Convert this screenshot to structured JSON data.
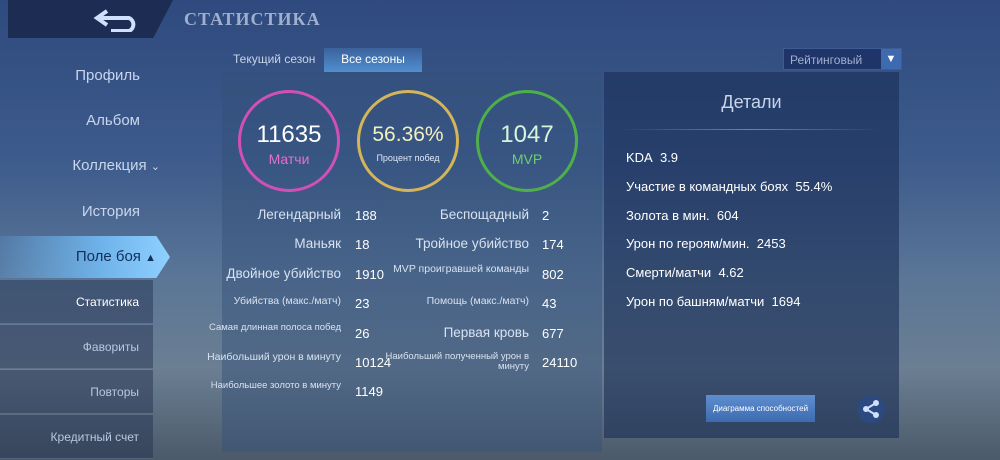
{
  "header": {
    "title": "СТАТИСТИКА"
  },
  "sidebar": {
    "items": [
      {
        "label": "Профиль"
      },
      {
        "label": "Альбом"
      },
      {
        "label": "Коллекция"
      },
      {
        "label": "История"
      },
      {
        "label": "Поле боя"
      }
    ],
    "sub_items": [
      {
        "label": "Статистика"
      },
      {
        "label": "Фавориты"
      },
      {
        "label": "Повторы"
      },
      {
        "label": "Кредитный счет"
      }
    ]
  },
  "tabs": [
    {
      "label": "Текущий сезон"
    },
    {
      "label": "Все сезоны"
    }
  ],
  "mode_select": {
    "value": "Рейтинговый"
  },
  "summary": [
    {
      "value": "11635",
      "label": "Матчи",
      "color": "#d24fb8"
    },
    {
      "value": "56.36%",
      "label": "Процент побед",
      "color": "#d4b55a"
    },
    {
      "value": "1047",
      "label": "MVP",
      "color": "#4fb04a"
    }
  ],
  "stats_left": [
    {
      "label": "Легендарный",
      "value": "188"
    },
    {
      "label": "Маньяк",
      "value": "18"
    },
    {
      "label": "Двойное убийство",
      "value": "1910"
    },
    {
      "label": "Убийства (макс./матч)",
      "value": "23"
    },
    {
      "label": "Самая длинная полоса побед",
      "value": "26"
    },
    {
      "label": "Наибольший урон в минуту",
      "value": "10124"
    },
    {
      "label": "Наибольшее золото в минуту",
      "value": "1149"
    }
  ],
  "stats_right": [
    {
      "label": "Беспощадный",
      "value": "2"
    },
    {
      "label": "Тройное убийство",
      "value": "174"
    },
    {
      "label": "MVP проигравшей команды",
      "value": "802"
    },
    {
      "label": "Помощь (макс./матч)",
      "value": "43"
    },
    {
      "label": "Первая кровь",
      "value": "677"
    },
    {
      "label": "Наибольший полученный урон в минуту",
      "value": "24110"
    }
  ],
  "details": {
    "title": "Детали",
    "items": [
      {
        "label": "KDA",
        "value": "3.9"
      },
      {
        "label": "Участие в командных боях",
        "value": "55.4%"
      },
      {
        "label": "Золота в мин.",
        "value": "604"
      },
      {
        "label": "Урон по героям/мин.",
        "value": "2453"
      },
      {
        "label": "Смерти/матчи",
        "value": "4.62"
      },
      {
        "label": "Урон по башням/матчи",
        "value": "1694"
      }
    ],
    "chart_button": "Диаграмма способностей"
  }
}
